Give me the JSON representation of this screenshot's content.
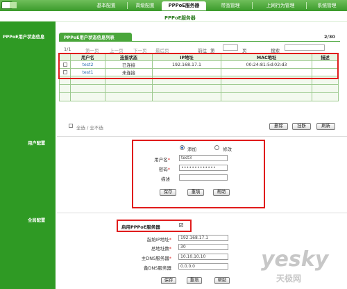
{
  "nav": {
    "tabs": [
      {
        "label": "基本配置"
      },
      {
        "label": "高级配置"
      },
      {
        "label": "PPPoE服务器"
      },
      {
        "label": "带宽管理"
      },
      {
        "label": "上网行为管理"
      },
      {
        "label": "系统管理"
      }
    ],
    "active_tab": 2,
    "subtitle": "PPPoE服务器"
  },
  "sidebar": {
    "status_label": "PPPoE用户状态信息",
    "user_config_label": "用户配置",
    "global_config_label": "全局配置"
  },
  "status_panel": {
    "title": "PPPoE用户状态信息列表",
    "page_count": "2/30",
    "page_index": "1/1",
    "pager": {
      "first": "第一页",
      "prev": "上一页",
      "next": "下一页",
      "last": "最后页",
      "goto_prefix": "前往",
      "goto_page": "第",
      "goto_suffix": "页",
      "search_label": "搜索"
    },
    "columns": [
      "用户名",
      "连接状态",
      "IP地址",
      "MAC地址",
      "描述"
    ],
    "rows": [
      {
        "username": "test2",
        "status": "已连接",
        "ip": "192.168.17.1",
        "mac": "00:24:81:5d:02:d3",
        "desc": ""
      },
      {
        "username": "test1",
        "status": "未连接",
        "ip": "",
        "mac": "",
        "desc": ""
      }
    ],
    "select_all_label": "全选 / 全不选",
    "buttons": {
      "delete": "删除",
      "hangup": "挂断",
      "refresh": "刷新"
    }
  },
  "user_config": {
    "mode_add": "添加",
    "mode_edit": "修改",
    "username_label": "用户名",
    "username_value": "test3",
    "password_label": "密码",
    "password_value": "•••••••••••••",
    "desc_label": "描述",
    "desc_value": "",
    "buttons": {
      "save": "保存",
      "reset": "重填",
      "help": "帮助"
    }
  },
  "global_config": {
    "enable_label": "启用PPPoE服务器",
    "enabled": true,
    "start_ip_label": "起始IP地址",
    "start_ip_value": "192.168.17.1",
    "total_addr_label": "总地址数",
    "total_addr_value": "30",
    "primary_dns_label": "主DNS服务器",
    "primary_dns_value": "10.10.10.10",
    "secondary_dns_label": "备DNS服务器",
    "secondary_dns_value": "0.0.0.0",
    "buttons": {
      "save": "保存",
      "reset": "重填",
      "help": "帮助"
    }
  },
  "watermark": {
    "brand": "yesky",
    "sub": "天极网"
  },
  "colors": {
    "nav_green": "#3a9a2a",
    "sidebar_green": "#2f9a24",
    "highlight_red": "#e01b1b",
    "link_blue": "#2b6fb0"
  }
}
